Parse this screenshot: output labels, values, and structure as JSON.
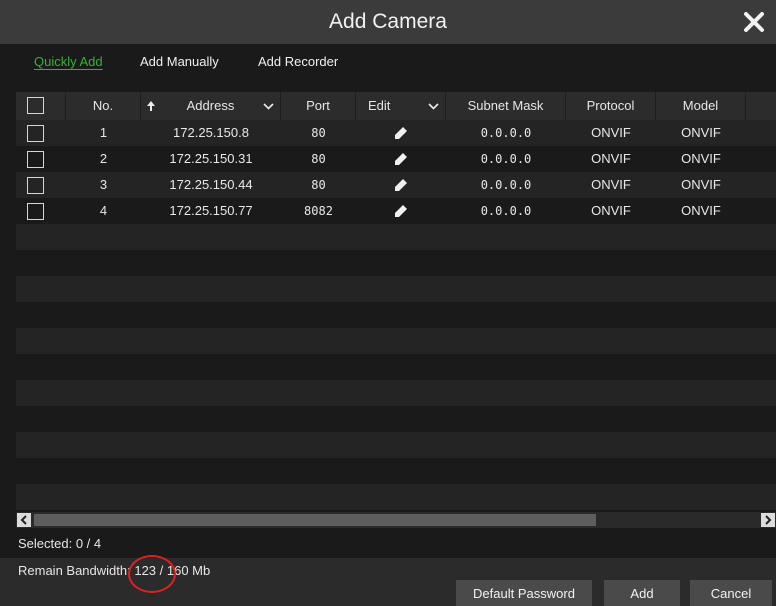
{
  "dialog": {
    "title": "Add Camera",
    "close_icon": "close-icon"
  },
  "tabs": [
    {
      "label": "Quickly Add",
      "active": true
    },
    {
      "label": "Add Manually",
      "active": false
    },
    {
      "label": "Add Recorder",
      "active": false
    }
  ],
  "table": {
    "columns": {
      "no": "No.",
      "address": "Address",
      "port": "Port",
      "edit": "Edit",
      "subnet": "Subnet Mask",
      "protocol": "Protocol",
      "model": "Model"
    },
    "rows": [
      {
        "no": "1",
        "address": "172.25.150.8",
        "port": "80",
        "subnet": "0.0.0.0",
        "protocol": "ONVIF",
        "model": "ONVIF"
      },
      {
        "no": "2",
        "address": "172.25.150.31",
        "port": "80",
        "subnet": "0.0.0.0",
        "protocol": "ONVIF",
        "model": "ONVIF"
      },
      {
        "no": "3",
        "address": "172.25.150.44",
        "port": "80",
        "subnet": "0.0.0.0",
        "protocol": "ONVIF",
        "model": "ONVIF"
      },
      {
        "no": "4",
        "address": "172.25.150.77",
        "port": "8082",
        "subnet": "0.0.0.0",
        "protocol": "ONVIF",
        "model": "ONVIF"
      }
    ]
  },
  "status": {
    "selected": "Selected: 0 / 4",
    "remain_bandwidth": "Remain Bandwidth: 123 / 160 Mb"
  },
  "buttons": {
    "default_password": "Default Password",
    "add": "Add",
    "cancel": "Cancel"
  },
  "colors": {
    "active_tab": "#2fb52f",
    "annotation_circle": "#e02020"
  }
}
